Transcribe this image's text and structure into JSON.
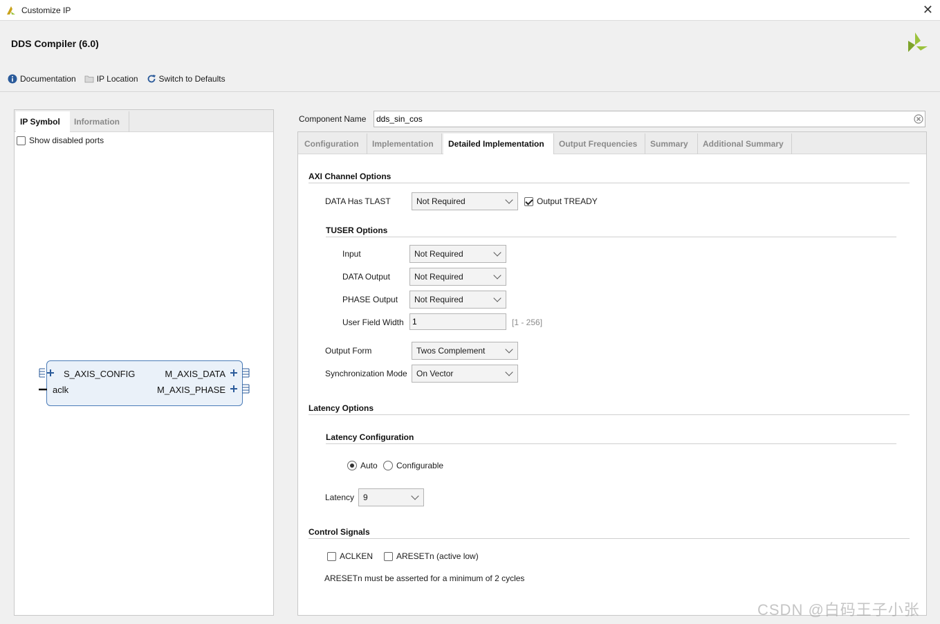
{
  "window": {
    "title": "Customize IP",
    "close_glyph": "✕"
  },
  "header": {
    "ip_title": "DDS Compiler (6.0)",
    "toolbar": {
      "documentation": "Documentation",
      "ip_location": "IP Location",
      "switch_defaults": "Switch to Defaults"
    }
  },
  "left_panel": {
    "tabs": [
      "IP Symbol",
      "Information"
    ],
    "show_disabled_ports": "Show disabled ports",
    "symbol": {
      "left_ports": [
        "S_AXIS_CONFIG",
        "aclk"
      ],
      "right_ports": [
        "M_AXIS_DATA",
        "M_AXIS_PHASE"
      ]
    }
  },
  "component": {
    "label": "Component Name",
    "value": "dds_sin_cos"
  },
  "right_tabs": [
    "Configuration",
    "Implementation",
    "Detailed Implementation",
    "Output Frequencies",
    "Summary",
    "Additional Summary"
  ],
  "axi": {
    "title": "AXI Channel Options",
    "data_has_tlast_label": "DATA Has TLAST",
    "data_has_tlast_value": "Not Required",
    "output_tready": "Output TREADY",
    "tuser_title": "TUSER Options",
    "input_label": "Input",
    "input_value": "Not Required",
    "data_output_label": "DATA Output",
    "data_output_value": "Not Required",
    "phase_output_label": "PHASE Output",
    "phase_output_value": "Not Required",
    "user_field_width_label": "User Field Width",
    "user_field_width_value": "1",
    "user_field_width_range": "[1 - 256]",
    "output_form_label": "Output Form",
    "output_form_value": "Twos Complement",
    "sync_mode_label": "Synchronization Mode",
    "sync_mode_value": "On Vector"
  },
  "latency": {
    "title": "Latency Options",
    "config_title": "Latency Configuration",
    "auto": "Auto",
    "configurable": "Configurable",
    "latency_label": "Latency",
    "latency_value": "9"
  },
  "control": {
    "title": "Control Signals",
    "aclken": "ACLKEN",
    "aresetn": "ARESETn (active low)",
    "note": "ARESETn must be asserted for a minimum of 2 cycles"
  },
  "watermark": "CSDN @白码王子小张",
  "colors": {
    "accent": "#2a5a9a",
    "logo": "#9bc23c"
  }
}
